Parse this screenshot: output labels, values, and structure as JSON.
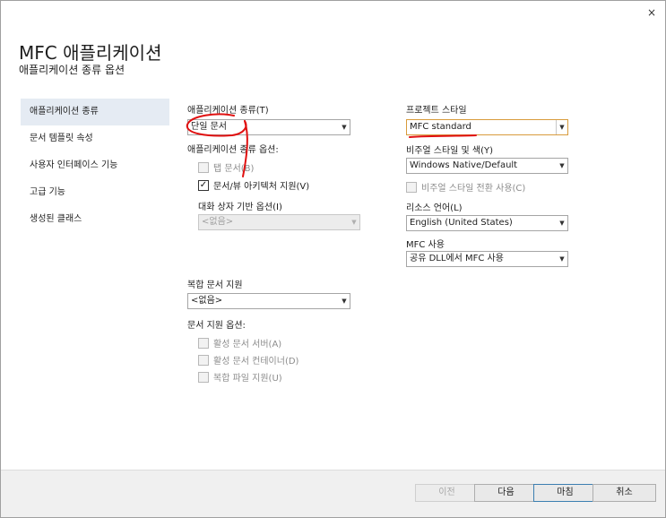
{
  "header": {
    "title": "MFC 애플리케이션",
    "subtitle": "애플리케이션 종류 옵션",
    "close": "×"
  },
  "sidebar": {
    "items": [
      {
        "label": "애플리케이션 종류",
        "active": true
      },
      {
        "label": "문서 템플릿 속성",
        "active": false
      },
      {
        "label": "사용자 인터페이스 기능",
        "active": false
      },
      {
        "label": "고급 기능",
        "active": false
      },
      {
        "label": "생성된 클래스",
        "active": false
      }
    ]
  },
  "left": {
    "app_type_label": "애플리케이션 종류(T)",
    "app_type_value": "단일 문서",
    "app_type_options_label": "애플리케이션 종류 옵션:",
    "tabbed_doc": "탭 문서(B)",
    "doc_view": "문서/뷰 아키텍처 지원(V)",
    "dialog_options_label": "대화 상자 기반 옵션(I)",
    "dialog_options_value": "<없음>",
    "compound_label": "복합 문서 지원",
    "compound_value": "<없음>",
    "doc_support_label": "문서 지원 옵션:",
    "active_server": "활성 문서 서버(A)",
    "active_container": "활성 문서 컨테이너(D)",
    "compound_file": "복합 파일 지원(U)"
  },
  "right": {
    "project_style_label": "프로젝트 스타일",
    "project_style_value": "MFC standard",
    "visual_style_label": "비주얼 스타일 및 색(Y)",
    "visual_style_value": "Windows Native/Default",
    "visual_switch": "비주얼 스타일 전환 사용(C)",
    "resource_lang_label": "리소스 언어(L)",
    "resource_lang_value": "English (United States)",
    "mfc_use_label": "MFC 사용",
    "mfc_use_value": "공유 DLL에서 MFC 사용"
  },
  "footer": {
    "prev": "이전",
    "next": "다음",
    "finish": "마침",
    "cancel": "취소"
  },
  "colors": {
    "sidebar_active": "#e5ebf3",
    "annotation": "#e01010",
    "focus_border": "#d89b3c"
  },
  "icons": {
    "close": "close-icon",
    "dropdown": "chevron-down-icon",
    "checkmark": "checkmark-icon"
  }
}
